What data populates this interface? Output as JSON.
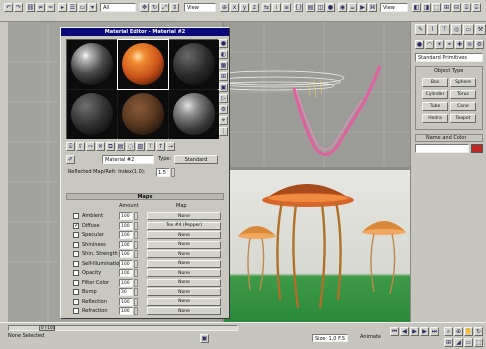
{
  "material_editor": {
    "title": "Material Editor - Material #2",
    "name_value": "Material #2",
    "type_label": "Type:",
    "type_value": "Standard",
    "reflectance_label": "Reflected Map/Refr. Index(1.0):",
    "reflectance_value": "1.5",
    "maps_header": "Maps",
    "amount_header": "Amount",
    "map_header": "Map",
    "maps": [
      {
        "name": "Ambient",
        "amount": "100",
        "checked": false,
        "map": "None"
      },
      {
        "name": "Diffuse",
        "amount": "100",
        "checked": true,
        "map": "Tex #4 (Pepper)"
      },
      {
        "name": "Specular",
        "amount": "100",
        "checked": false,
        "map": "None"
      },
      {
        "name": "Shininess",
        "amount": "100",
        "checked": false,
        "map": "None"
      },
      {
        "name": "Shin. Strength",
        "amount": "100",
        "checked": false,
        "map": "None"
      },
      {
        "name": "Self-Illumination",
        "amount": "100",
        "checked": false,
        "map": "None"
      },
      {
        "name": "Opacity",
        "amount": "100",
        "checked": false,
        "map": "None"
      },
      {
        "name": "Filter Color",
        "amount": "100",
        "checked": false,
        "map": "None"
      },
      {
        "name": "Bump",
        "amount": "30",
        "checked": false,
        "map": "None"
      },
      {
        "name": "Reflection",
        "amount": "100",
        "checked": false,
        "map": "None"
      },
      {
        "name": "Refraction",
        "amount": "100",
        "checked": false,
        "map": "None"
      }
    ]
  },
  "command_panel": {
    "dropdown_value": "Standard Primitives",
    "section_title": "Object Type",
    "buttons": [
      "Box",
      "Sphere",
      "Cylinder",
      "Torus",
      "Tube",
      "Cone",
      "Hedra",
      "Teapot"
    ],
    "name_section": "Name and Color"
  },
  "toolbar": {
    "zoom_value": "All",
    "filter_value": "View",
    "selection_value": "View"
  },
  "status": {
    "left_text": "None Selected",
    "frame_text": "0 / 100",
    "coords_text": "Size: 1.0 F.S",
    "animate_label": "Animate"
  }
}
